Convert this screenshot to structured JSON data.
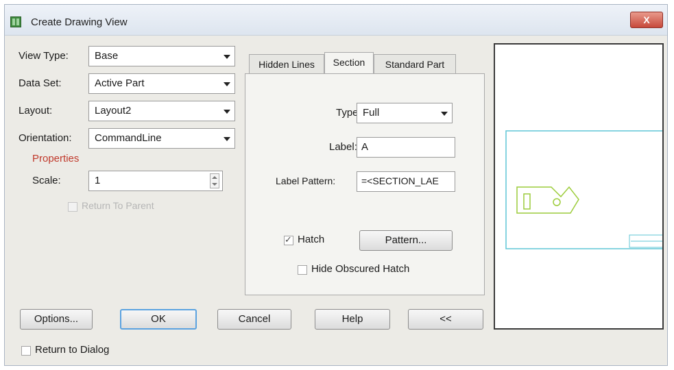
{
  "window": {
    "title": "Create Drawing View",
    "close_label": "X"
  },
  "left": {
    "view_type": {
      "label": "View Type:",
      "value": "Base"
    },
    "data_set": {
      "label": "Data Set:",
      "value": "Active Part"
    },
    "layout": {
      "label": "Layout:",
      "value": "Layout2"
    },
    "orientation": {
      "label": "Orientation:",
      "value": "CommandLine"
    },
    "properties_label": "Properties",
    "scale": {
      "label": "Scale:",
      "value": "1"
    },
    "return_to_parent": "Return To Parent"
  },
  "tabs": [
    "Hidden Lines",
    "Section",
    "Standard Part"
  ],
  "active_tab": "Section",
  "section": {
    "type": {
      "label": "Type:",
      "value": "Full"
    },
    "label_field": {
      "label": "Label:",
      "value": "A"
    },
    "label_pattern": {
      "label": "Label Pattern:",
      "value": "=<SECTION_LAE"
    },
    "hatch": {
      "label": "Hatch",
      "checked": true
    },
    "pattern_button": "Pattern...",
    "hide_obscured_hatch": {
      "label": "Hide Obscured Hatch",
      "checked": false
    }
  },
  "buttons": {
    "options": "Options...",
    "ok": "OK",
    "cancel": "Cancel",
    "help": "Help",
    "collapse": "<<"
  },
  "return_to_dialog": {
    "label": "Return to Dialog",
    "checked": false
  },
  "colors": {
    "preview_frame": "#5fc6d6",
    "part_outline": "#9ccc3a"
  }
}
